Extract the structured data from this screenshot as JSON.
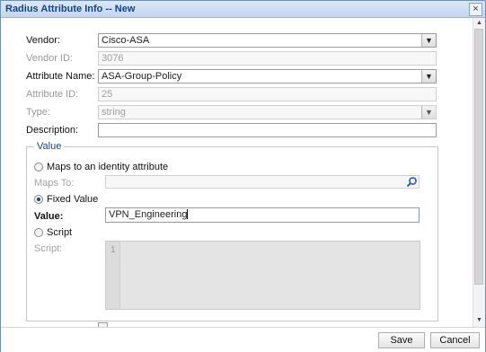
{
  "dialog": {
    "title": "Radius Attribute Info -- New",
    "close_glyph": "×"
  },
  "form": {
    "vendor_label": "Vendor:",
    "vendor_value": "Cisco-ASA",
    "vendor_id_label": "Vendor ID:",
    "vendor_id_value": "3076",
    "attribute_name_label": "Attribute Name:",
    "attribute_name_value": "ASA-Group-Policy",
    "attribute_id_label": "Attribute ID:",
    "attribute_id_value": "25",
    "type_label": "Type:",
    "type_value": "string",
    "description_label": "Description:",
    "description_value": ""
  },
  "value_group": {
    "legend": "Value",
    "maps_option": "Maps to an identity attribute",
    "maps_to_label": "Maps To:",
    "maps_to_value": "",
    "fixed_option": "Fixed Value",
    "fixed_value_label": "Value:",
    "fixed_value": "VPN_Engineering",
    "script_option": "Script",
    "script_label": "Script:",
    "script_line_number": "1",
    "selected": "fixed"
  },
  "icons": {
    "dropdown": "chevron-down-icon",
    "search": "search-icon",
    "close": "close-icon"
  },
  "footer": {
    "save_label": "Save",
    "cancel_label": "Cancel"
  },
  "colors": {
    "title_text": "#15428b",
    "titlebar": "#c4d6ee",
    "border": "#6f8fb8"
  }
}
